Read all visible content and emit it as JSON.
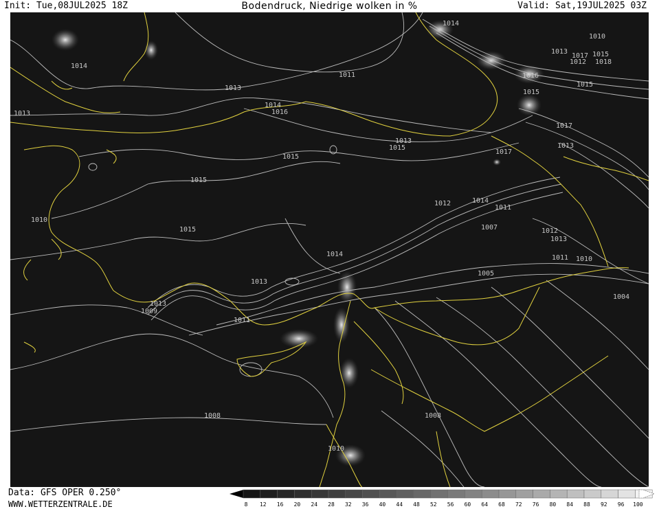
{
  "header": {
    "init": "Init: Tue,08JUL2025 18Z",
    "title": "Bodendruck, Niedrige wolken in %",
    "valid": "Valid: Sat,19JUL2025 03Z"
  },
  "footer": {
    "data_source": "Data: GFS OPER 0.250°",
    "website": "WWW.WETTERZENTRALE.DE"
  },
  "colorbar": {
    "labels": [
      "8",
      "12",
      "16",
      "20",
      "24",
      "28",
      "32",
      "36",
      "40",
      "44",
      "48",
      "52",
      "56",
      "60",
      "64",
      "68",
      "72",
      "76",
      "80",
      "84",
      "88",
      "92",
      "96",
      "100"
    ],
    "colors": [
      "#151515",
      "#1e1e1e",
      "#272727",
      "#2f2f2f",
      "#373737",
      "#3f3f3f",
      "#474747",
      "#4f4f4f",
      "#585858",
      "#606060",
      "#686868",
      "#717171",
      "#7a7a7a",
      "#838383",
      "#8c8c8c",
      "#969696",
      "#a0a0a0",
      "#aaaaaa",
      "#b4b4b4",
      "#bfbfbf",
      "#cacaca",
      "#d6d6d6",
      "#e3e3e3",
      "#f2f2f2"
    ]
  },
  "map": {
    "background_color": "#151515",
    "isobar_color": "#c8c8c8",
    "border_color": "#e0d040",
    "isobar_labels": [
      "1014",
      "1013",
      "1011",
      "1013",
      "1014",
      "1016",
      "1015",
      "1013",
      "1015",
      "1017",
      "1014",
      "1010",
      "1012",
      "1013",
      "1017",
      "1015",
      "1018",
      "1016",
      "1015",
      "1017",
      "1015",
      "1013",
      "1015",
      "1015",
      "1012",
      "1014",
      "1011",
      "1007",
      "1012",
      "1013",
      "1010",
      "1011",
      "1010",
      "1005",
      "1004",
      "1014",
      "1013",
      "1013",
      "1009",
      "1011",
      "1008",
      "1008",
      "1010"
    ]
  }
}
